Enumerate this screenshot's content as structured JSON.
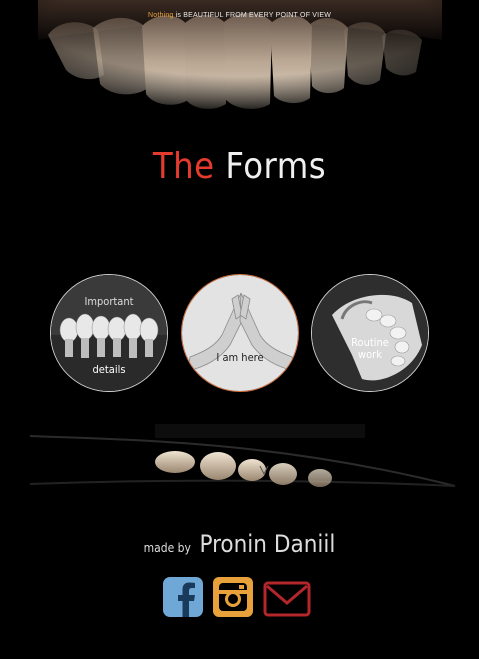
{
  "header": {
    "tagline_accent": "Nothing",
    "tagline_rest": "is BEAUTIFUL FROM EVERY POINT OF VIEW"
  },
  "title": {
    "part1": "The",
    "part2": "Forms"
  },
  "circles": [
    {
      "label_top": "Important",
      "label_bottom": "details"
    },
    {
      "label": "I am here"
    },
    {
      "label_line1": "Routine",
      "label_line2": "work"
    }
  ],
  "credit": {
    "prefix": "made by",
    "name": "Pronin Daniil"
  },
  "social": [
    {
      "icon": "facebook-icon",
      "color": "#6fa8d6"
    },
    {
      "icon": "instagram-icon",
      "color": "#e9a23b"
    },
    {
      "icon": "mail-icon",
      "color": "#b3262a"
    }
  ],
  "colors": {
    "accent_red": "#e53a2e",
    "accent_orange": "#e9a23b",
    "background": "#000000"
  }
}
